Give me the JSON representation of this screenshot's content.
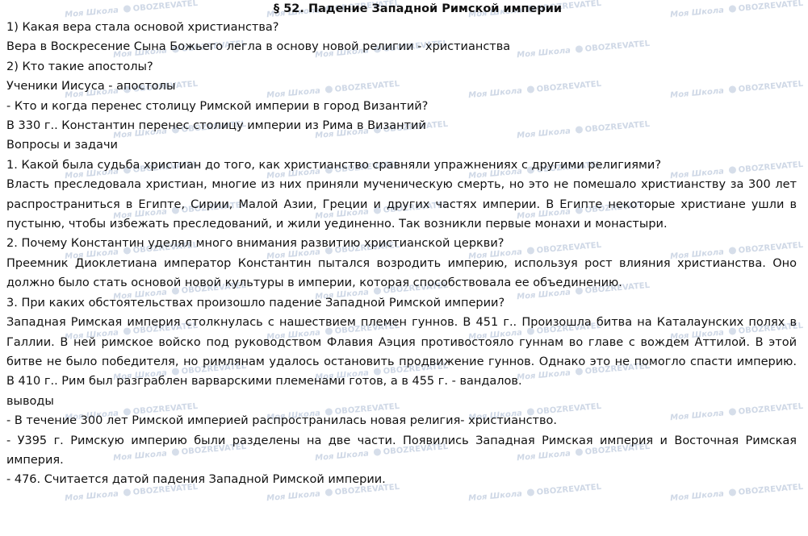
{
  "title": "§ 52. Падение Западной Римской империи",
  "watermark": {
    "school": "Моя Школа",
    "brand": "OBOZREVATEL"
  },
  "lines": {
    "q1": "1) Какая вера стала основой христианства?",
    "a1": "Вера в Воскресение Сына Божьего легла в основу новой религии - христианства",
    "q2": "2) Кто такие апостолы?",
    "a2": "Ученики Иисуса - апостолы",
    "q3": "- Кто и когда перенес столицу Римской империи в город Византий?",
    "a3": "В 330 г.. Константин перенес столицу империи из Рима в Византий",
    "section": "Вопросы и задачи",
    "t1": "1. Какой была судьба христиан до того, как христианство сравняли упражнениях с другими религиями?",
    "t1a": "Власть преследовала христиан, многие из них приняли мученическую смерть, но это не помешало христианству за 300 лет распространиться в Египте, Сирии, Малой Азии, Греции и других частях империи. В Египте некоторые христиане ушли в пустыню, чтобы избежать преследований, и жили уединенно. Так возникли первые монахи и монастыри.",
    "t2": "2. Почему Константин уделял много внимания развитию христианской церкви?",
    "t2a": "Преемник Диоклетиана император Константин пытался возродить империю, используя рост влияния христианства. Оно должно было стать основой новой культуры в империи, которая способствовала ее объединению.",
    "t3": "3. При каких обстоятельствах произошло падение Западной Римской империи?",
    "t3a": "Западная Римская империя столкнулась с нашествием племен гуннов. В 451 г.. Произошла битва на Каталаунских полях в Галлии. В ней римское войско под руководством Флавия Аэция противостояло гуннам во главе с вождем Аттилой. В этой битве не было победителя, но римлянам удалось остановить продвижение гуннов. Однако это не помогло спасти империю. В 410 г.. Рим был разграблен варварскими племенами готов, а в 455 г. - вандалов.",
    "conclusions": "выводы",
    "c1": "- В течение 300 лет Римской империей распространилась новая религия- христианство.",
    "c2": "- У395 г. Римскую империю были разделены на две части. Появились Западная Римская империя и Восточная Римская империя.",
    "c3": "- 476. Считается датой падения Западной Римской империи."
  }
}
